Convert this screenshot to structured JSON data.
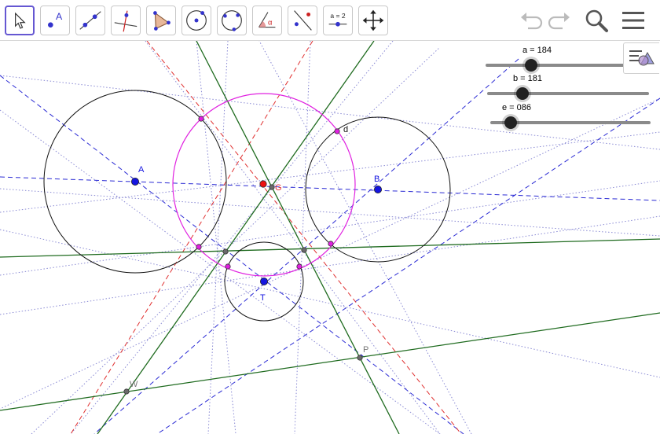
{
  "toolbar": {
    "tools": [
      {
        "name": "move-tool",
        "icon": "arrow-cursor-icon",
        "active": true
      },
      {
        "name": "point-tool",
        "icon": "point-a-icon",
        "label": "A"
      },
      {
        "name": "line-tool",
        "icon": "line-through-points-icon"
      },
      {
        "name": "perpendicular-line-tool",
        "icon": "perpendicular-line-icon"
      },
      {
        "name": "polygon-tool",
        "icon": "polygon-icon"
      },
      {
        "name": "circle-tool",
        "icon": "circle-center-point-icon"
      },
      {
        "name": "circle-three-points-tool",
        "icon": "circle-three-points-icon"
      },
      {
        "name": "angle-tool",
        "icon": "angle-icon",
        "label": "α"
      },
      {
        "name": "reflect-tool",
        "icon": "reflect-about-line-icon"
      },
      {
        "name": "slider-tool",
        "icon": "slider-icon",
        "label": "a = 2"
      },
      {
        "name": "move-graphics-view-tool",
        "icon": "move-arrows-icon"
      }
    ],
    "right": [
      {
        "name": "undo-button",
        "icon": "undo-icon"
      },
      {
        "name": "redo-button",
        "icon": "redo-icon"
      },
      {
        "name": "search-button",
        "icon": "search-icon"
      },
      {
        "name": "menu-button",
        "icon": "hamburger-menu-icon"
      }
    ]
  },
  "sliders": [
    {
      "name": "slider-a",
      "label": "a = 184",
      "position": 0.47
    },
    {
      "name": "slider-b",
      "label": "b = 181",
      "position": 0.22
    },
    {
      "name": "slider-e",
      "label": "e = 086",
      "position": 0.14
    }
  ],
  "points": {
    "A": "A",
    "B": "B",
    "T": "T",
    "G": "G",
    "P": "P",
    "W": "W",
    "d": "d"
  },
  "colors": {
    "accent": "#6557d2",
    "point_blue": "#0000ff",
    "circle_magenta": "#e000e0",
    "line_green": "#006400",
    "dashed_blue": "#0000cc",
    "dashed_red": "#dd0000",
    "dotted": "#8080d0"
  }
}
